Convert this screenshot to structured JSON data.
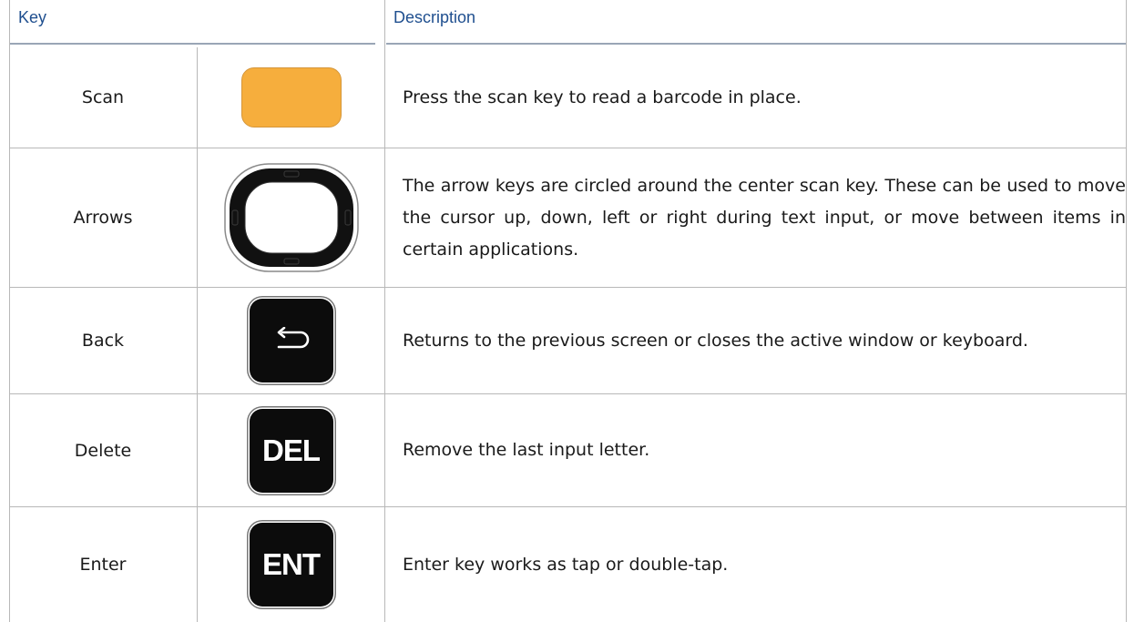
{
  "table": {
    "headers": {
      "key": "Key",
      "description": "Description"
    },
    "colors": {
      "header_text": "#1f4f8f",
      "scan_key": "#f6ae3d",
      "dark_key": "#0c0c0c"
    },
    "rows": [
      {
        "name": "Scan",
        "icon": "scan-key-icon",
        "description": "Press the scan key to read a barcode in place."
      },
      {
        "name": "Arrows",
        "icon": "arrow-ring-key-icon",
        "description": "The arrow keys are circled around the center scan key. These can be used to move the cursor up, down, left or right during text input, or move between items in certain applications."
      },
      {
        "name": "Back",
        "icon": "back-key-icon",
        "description": "Returns to the previous screen or closes the active window or keyboard."
      },
      {
        "name": "Delete",
        "icon": "delete-key-icon",
        "key_label": "DEL",
        "description": "Remove the last input letter."
      },
      {
        "name": "Enter",
        "icon": "enter-key-icon",
        "key_label": "ENT",
        "description": "Enter key works as tap or double-tap."
      }
    ]
  }
}
